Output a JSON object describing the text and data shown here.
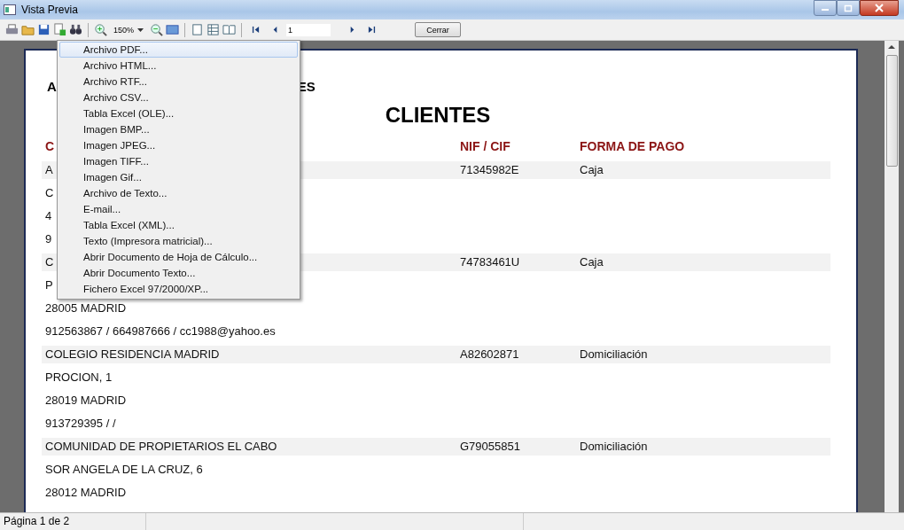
{
  "window": {
    "title": "Vista Previa"
  },
  "toolbar": {
    "zoom": "150%",
    "page": "1",
    "close_button": "Cerrar"
  },
  "export_menu": {
    "items": [
      {
        "label": "Archivo PDF...",
        "selected": true
      },
      {
        "label": "Archivo HTML...",
        "selected": false
      },
      {
        "label": "Archivo RTF...",
        "selected": false
      },
      {
        "label": "Archivo CSV...",
        "selected": false
      },
      {
        "label": "Tabla Excel (OLE)...",
        "selected": false
      },
      {
        "label": "Imagen BMP...",
        "selected": false
      },
      {
        "label": "Imagen JPEG...",
        "selected": false
      },
      {
        "label": "Imagen TIFF...",
        "selected": false
      },
      {
        "label": "Imagen Gif...",
        "selected": false
      },
      {
        "label": "Archivo de Texto...",
        "selected": false
      },
      {
        "label": "E-mail...",
        "selected": false
      },
      {
        "label": "Tabla Excel (XML)...",
        "selected": false
      },
      {
        "label": "Texto (Impresora matricial)...",
        "selected": false
      },
      {
        "label": "Abrir Documento de Hoja de Cálculo...",
        "selected": false
      },
      {
        "label": "Abrir Documento Texto...",
        "selected": false
      },
      {
        "label": "Fichero Excel 97/2000/XP...",
        "selected": false
      }
    ]
  },
  "report": {
    "heading_fragments": [
      "A",
      "ES"
    ],
    "title": "CLIENTES",
    "columns": [
      "C",
      "NIF / CIF",
      "FORMA DE PAGO"
    ],
    "clients": [
      {
        "name": "A",
        "nif": "71345982E",
        "payment": "Caja",
        "lines": [
          "C",
          "4",
          "9"
        ]
      },
      {
        "name": "C",
        "nif": "74783461U",
        "payment": "Caja",
        "lines": [
          "P",
          "28005 MADRID",
          "912563867 / 664987666 / cc1988@yahoo.es"
        ]
      },
      {
        "name": "COLEGIO RESIDENCIA MADRID",
        "nif": "A82602871",
        "payment": "Domiciliación",
        "lines": [
          "PROCION, 1",
          "28019 MADRID",
          "913729395 /  /"
        ]
      },
      {
        "name": "COMUNIDAD DE PROPIETARIOS EL CABO",
        "nif": "G79055851",
        "payment": "Domiciliación",
        "lines": [
          "SOR ANGELA DE LA CRUZ, 6",
          "28012 MADRID"
        ]
      }
    ]
  },
  "status_bar": {
    "page_info": "Página 1 de 2"
  }
}
